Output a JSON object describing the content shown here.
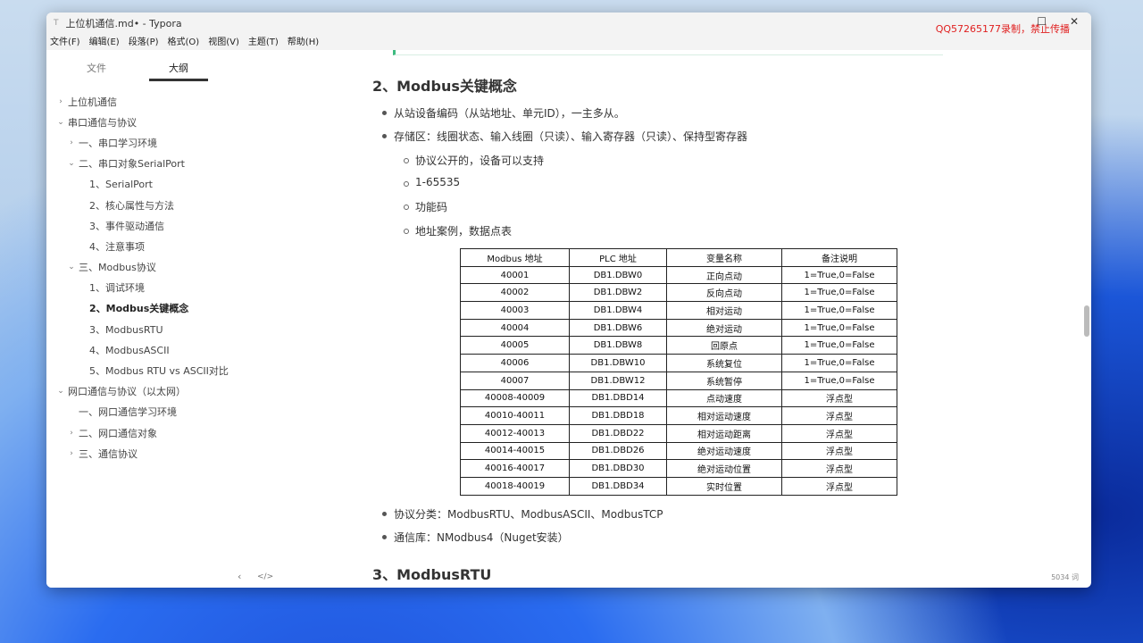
{
  "window": {
    "title": "上位机通信.md• - Typora",
    "watermark": "QQ57265177录制，禁止传播"
  },
  "menu": [
    "文件(F)",
    "编辑(E)",
    "段落(P)",
    "格式(O)",
    "视图(V)",
    "主题(T)",
    "帮助(H)"
  ],
  "sidebar": {
    "tabs": [
      "文件",
      "大纲"
    ],
    "outline": [
      {
        "label": "上位机通信",
        "caret": "›",
        "level": 0
      },
      {
        "label": "串口通信与协议",
        "caret": "⌄",
        "level": 0
      },
      {
        "label": "一、串口学习环境",
        "caret": "›",
        "level": 1
      },
      {
        "label": "二、串口对象SerialPort",
        "caret": "⌄",
        "level": 1
      },
      {
        "label": "1、SerialPort",
        "caret": "",
        "level": 2
      },
      {
        "label": "2、核心属性与方法",
        "caret": "",
        "level": 2
      },
      {
        "label": "3、事件驱动通信",
        "caret": "",
        "level": 2
      },
      {
        "label": "4、注意事项",
        "caret": "",
        "level": 2
      },
      {
        "label": "三、Modbus协议",
        "caret": "⌄",
        "level": 1
      },
      {
        "label": "1、调试环境",
        "caret": "",
        "level": 2
      },
      {
        "label": "2、Modbus关键概念",
        "caret": "",
        "level": 2,
        "active": true
      },
      {
        "label": "3、ModbusRTU",
        "caret": "",
        "level": 2
      },
      {
        "label": "4、ModbusASCII",
        "caret": "",
        "level": 2
      },
      {
        "label": "5、Modbus RTU vs ASCII对比",
        "caret": "",
        "level": 2
      },
      {
        "label": "网口通信与协议（以太网）",
        "caret": "⌄",
        "level": 0
      },
      {
        "label": "一、网口通信学习环境",
        "caret": "",
        "level": 1
      },
      {
        "label": "二、网口通信对象",
        "caret": "›",
        "level": 1
      },
      {
        "label": "三、通信协议",
        "caret": "›",
        "level": 1
      }
    ]
  },
  "doc": {
    "heading": "2、Modbus关键概念",
    "bullets": [
      "从站设备编码（从站地址、单元ID），一主多从。",
      "存储区：线圈状态、输入线圈（只读）、输入寄存器（只读）、保持型寄存器"
    ],
    "sub_bullets": [
      "协议公开的，设备可以支持",
      "1-65535",
      "功能码",
      "地址案例，数据点表"
    ],
    "table": {
      "headers": [
        "Modbus 地址",
        "PLC 地址",
        "变量名称",
        "备注说明"
      ],
      "rows": [
        [
          "40001",
          "DB1.DBW0",
          "正向点动",
          "1=True,0=False"
        ],
        [
          "40002",
          "DB1.DBW2",
          "反向点动",
          "1=True,0=False"
        ],
        [
          "40003",
          "DB1.DBW4",
          "相对运动",
          "1=True,0=False"
        ],
        [
          "40004",
          "DB1.DBW6",
          "绝对运动",
          "1=True,0=False"
        ],
        [
          "40005",
          "DB1.DBW8",
          "回原点",
          "1=True,0=False"
        ],
        [
          "40006",
          "DB1.DBW10",
          "系统复位",
          "1=True,0=False"
        ],
        [
          "40007",
          "DB1.DBW12",
          "系统暂停",
          "1=True,0=False"
        ],
        [
          "40008-40009",
          "DB1.DBD14",
          "点动速度",
          "浮点型"
        ],
        [
          "40010-40011",
          "DB1.DBD18",
          "相对运动速度",
          "浮点型"
        ],
        [
          "40012-40013",
          "DB1.DBD22",
          "相对运动距离",
          "浮点型"
        ],
        [
          "40014-40015",
          "DB1.DBD26",
          "绝对运动速度",
          "浮点型"
        ],
        [
          "40016-40017",
          "DB1.DBD30",
          "绝对运动位置",
          "浮点型"
        ],
        [
          "40018-40019",
          "DB1.DBD34",
          "实时位置",
          "浮点型"
        ]
      ]
    },
    "bullets2": [
      "协议分类：ModbusRTU、ModbusASCII、ModbusTCP",
      "通信库：NModbus4（Nuget安装）"
    ],
    "heading2": "3、ModbusRTU"
  },
  "status": {
    "word_count": "5034 词",
    "nav_prev": "‹",
    "source_toggle": "</>"
  }
}
